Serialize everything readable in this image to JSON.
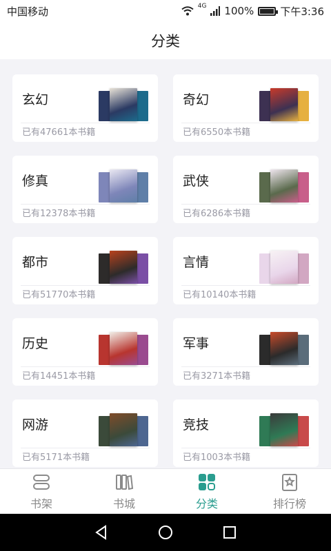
{
  "status_bar": {
    "carrier": "中国移动",
    "network": "4G",
    "battery": "100%",
    "battery_level": 1.0,
    "time": "下午3:36"
  },
  "header": {
    "title": "分类"
  },
  "categories": [
    {
      "name": "玄幻",
      "count": "已有47661本书籍",
      "colors": [
        "#2b3a63",
        "#e9e3d8",
        "#1d6b8c"
      ]
    },
    {
      "name": "奇幻",
      "count": "已有6550本书籍",
      "colors": [
        "#3d3152",
        "#c83a2a",
        "#e6b040"
      ]
    },
    {
      "name": "修真",
      "count": "已有12378本书籍",
      "colors": [
        "#7e86b9",
        "#eae8f2",
        "#5f7fa8"
      ]
    },
    {
      "name": "武侠",
      "count": "已有6286本书籍",
      "colors": [
        "#5a6a4c",
        "#efe6ee",
        "#c85f8a"
      ]
    },
    {
      "name": "都市",
      "count": "已有51770本书籍",
      "colors": [
        "#2d2b2a",
        "#b8421d",
        "#7a4fa5"
      ]
    },
    {
      "name": "言情",
      "count": "已有10140本书籍",
      "colors": [
        "#e9d6ea",
        "#f7f2f4",
        "#d2a7c2"
      ]
    },
    {
      "name": "历史",
      "count": "已有14451本书籍",
      "colors": [
        "#b8352f",
        "#f1eee7",
        "#9a4b8f"
      ]
    },
    {
      "name": "军事",
      "count": "已有3271本书籍",
      "colors": [
        "#2b2b2b",
        "#c84a2a",
        "#5a6c7a"
      ]
    },
    {
      "name": "网游",
      "count": "已有5171本书籍",
      "colors": [
        "#3b4a3a",
        "#7f4c2a",
        "#4d6690"
      ]
    },
    {
      "name": "竞技",
      "count": "已有1003本书籍",
      "colors": [
        "#2f7a55",
        "#3b3b3b",
        "#c84a4a"
      ]
    }
  ],
  "tabs": [
    {
      "label": "书架",
      "icon": "bookshelf-icon",
      "active": false
    },
    {
      "label": "书城",
      "icon": "bookstore-icon",
      "active": false
    },
    {
      "label": "分类",
      "icon": "category-icon",
      "active": true
    },
    {
      "label": "排行榜",
      "icon": "ranking-icon",
      "active": false
    }
  ],
  "colors": {
    "accent": "#2a9d8f",
    "page_bg": "#f3f3f7",
    "muted_text": "#9a9aa5"
  }
}
